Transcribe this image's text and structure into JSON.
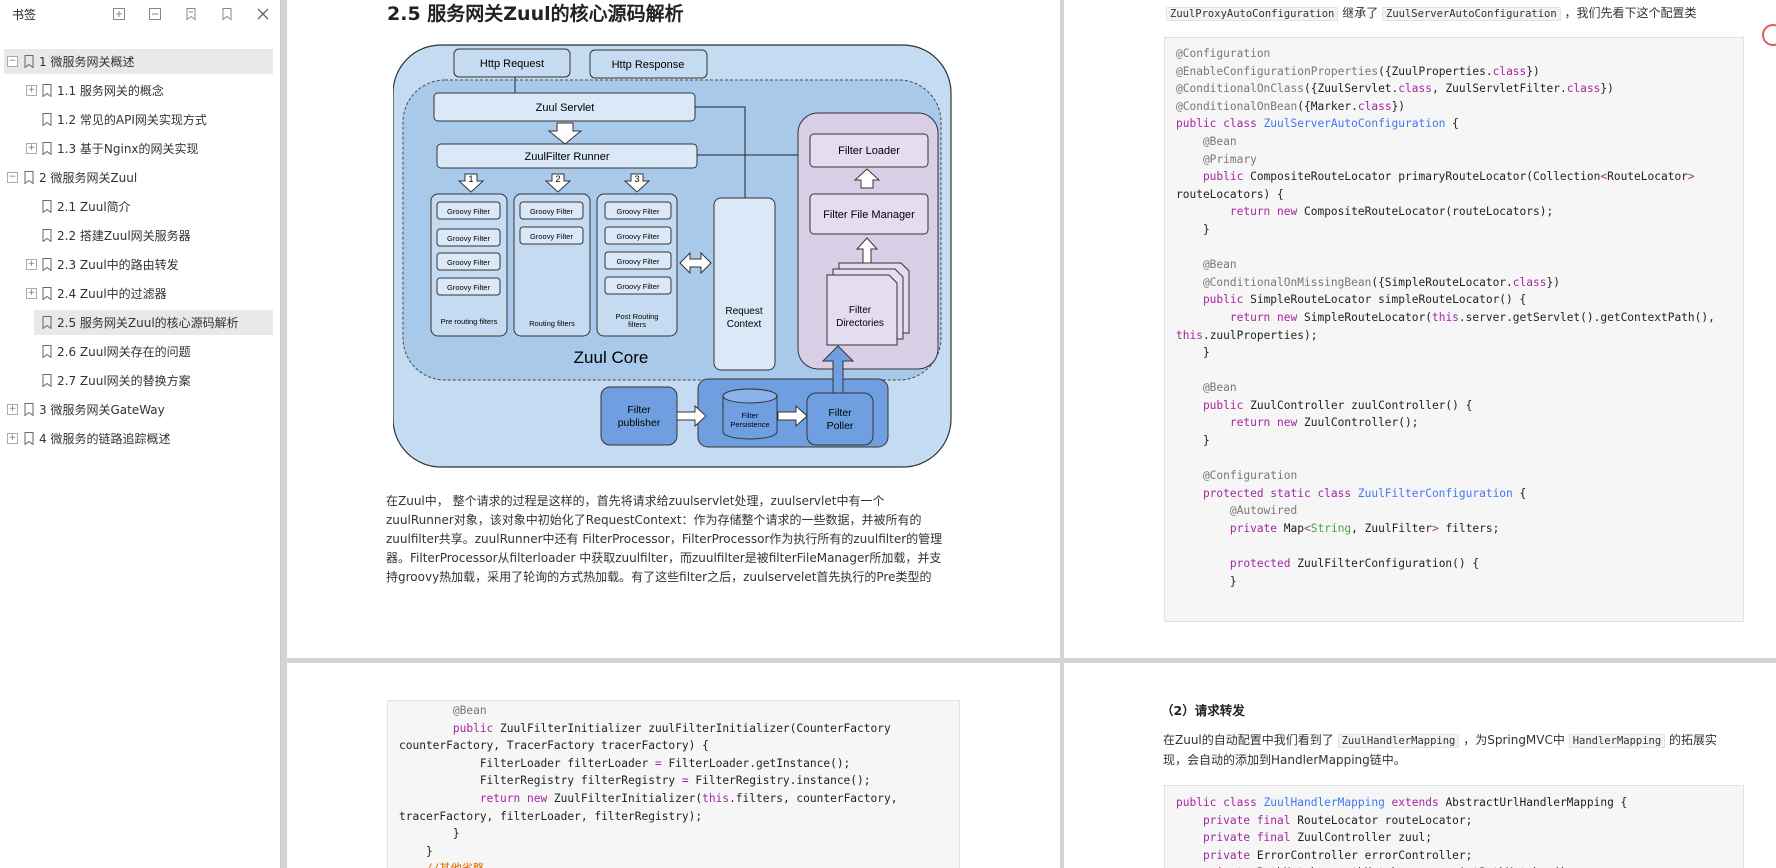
{
  "sidebar": {
    "title": "书签",
    "toc": [
      {
        "label": "1 微服务网关概述",
        "level": 1,
        "sel": true,
        "exp": "⊟"
      },
      {
        "label": "1.1 服务网关的概念",
        "level": 2,
        "exp": "⊞"
      },
      {
        "label": "1.2 常见的API网关实现方式",
        "level": 2,
        "exp": ""
      },
      {
        "label": "1.3 基于Nginx的网关实现",
        "level": 2,
        "exp": "⊞"
      },
      {
        "label": "2 微服务网关Zuul",
        "level": 1,
        "exp": "⊟"
      },
      {
        "label": "2.1 Zuul简介",
        "level": 2,
        "exp": ""
      },
      {
        "label": "2.2 搭建Zuul网关服务器",
        "level": 2,
        "exp": ""
      },
      {
        "label": "2.3 Zuul中的路由转发",
        "level": 2,
        "exp": "⊞"
      },
      {
        "label": "2.4 Zuul中的过滤器",
        "level": 2,
        "exp": "⊞"
      },
      {
        "label": "2.5 服务网关Zuul的核心源码解析",
        "level": 2,
        "sel": true,
        "exp": ""
      },
      {
        "label": "2.6  Zuul网关存在的问题",
        "level": 2,
        "exp": ""
      },
      {
        "label": "2.7 Zuul网关的替换方案",
        "level": 2,
        "exp": ""
      },
      {
        "label": "3 微服务网关GateWay",
        "level": 1,
        "exp": "⊞"
      },
      {
        "label": "4 微服务的链路追踪概述",
        "level": 1,
        "exp": "⊞"
      }
    ]
  },
  "page1": {
    "heading": "2.5 服务网关Zuul的核心源码解析",
    "para": [
      "在Zuul中， 整个请求的过程是这样的，首先将请求给zuulservlet处理，zuulservlet中有一个",
      "zuulRunner对象，该对象中初始化了RequestContext：作为存储整个请求的一些数据，并被所有的",
      "zuulfilter共享。zuulRunner中还有 FilterProcessor，FilterProcessor作为执行所有的zuulfilter的管理",
      "器。FilterProcessor从filterloader 中获取zuulfilter，而zuulfilter是被filterFileManager所加载，并支",
      "持groovy热加载，采用了轮询的方式热加载。有了这些filter之后，zuulservelet首先执行的Pre类型的"
    ]
  },
  "diagram": {
    "http_request": "Http Request",
    "http_response": "Http Response",
    "zuul_servlet": "Zuul Servlet",
    "runner": "ZuulFilter Runner",
    "groovy": "Groovy Filter",
    "pre": "Pre routing filters",
    "routing": "Routing filters",
    "post_1": "Post Routing",
    "post_2": "filters",
    "rc_1": "Request",
    "rc_2": "Context",
    "core": "Zuul Core",
    "loader": "Filter Loader",
    "file_mgr": "Filter File Manager",
    "dir_1": "Filter",
    "dir_2": "Directories",
    "pub_1": "Filter",
    "pub_2": "publisher",
    "pers_1": "Filter",
    "pers_2": "Persistence",
    "poll_1": "Filter",
    "poll_2": "Poller",
    "n1": "1",
    "n2": "2",
    "n3": "3"
  },
  "page2": {
    "intro_a": "ZuulProxyAutoConfiguration",
    "intro_b": " 继承了 ",
    "intro_c": "ZuulServerAutoConfiguration",
    "intro_d": " ，我们先看下这个配置类"
  },
  "page4": {
    "heading": "（2）请求转发",
    "p1a": "在Zuul的自动配置中我们看到了 ",
    "p1b": "ZuulHandlerMapping",
    "p1c": " ，为SpringMVC中 ",
    "p1d": "HandlerMapping",
    "p1e": " 的拓展实",
    "p2": "现，会自动的添加到HandlerMapping链中。"
  },
  "code2": [
    [
      [
        "an",
        "@Configuration"
      ]
    ],
    [
      [
        "an",
        "@EnableConfigurationProperties"
      ],
      [
        "",
        "({ZuulProperties."
      ],
      [
        "kw",
        "class"
      ],
      [
        "",
        "})"
      ]
    ],
    [
      [
        "an",
        "@ConditionalOnClass"
      ],
      [
        "",
        "({ZuulServlet."
      ],
      [
        "kw",
        "class"
      ],
      [
        "",
        ", ZuulServletFilter."
      ],
      [
        "kw",
        "class"
      ],
      [
        "",
        "})"
      ]
    ],
    [
      [
        "an",
        "@ConditionalOnBean"
      ],
      [
        "",
        "({Marker."
      ],
      [
        "kw",
        "class"
      ],
      [
        "",
        "})"
      ]
    ],
    [
      [
        "kw",
        "public class "
      ],
      [
        "ty",
        "ZuulServerAutoConfiguration"
      ],
      [
        "",
        " {"
      ]
    ],
    [
      [
        "an",
        "    @Bean"
      ]
    ],
    [
      [
        "an",
        "    @Primary"
      ]
    ],
    [
      [
        "kw",
        "    public "
      ],
      [
        "",
        "CompositeRouteLocator primaryRouteLocator(Collection"
      ],
      [
        "kw",
        "<"
      ],
      [
        "",
        "RouteLocator"
      ],
      [
        "kw",
        ">"
      ]
    ],
    [
      [
        "",
        "routeLocators) {"
      ]
    ],
    [
      [
        "kw",
        "        return new "
      ],
      [
        "",
        "CompositeRouteLocator(routeLocators);"
      ]
    ],
    [
      [
        "",
        "    }"
      ]
    ],
    [
      [
        "",
        ""
      ]
    ],
    [
      [
        "an",
        "    @Bean"
      ]
    ],
    [
      [
        "an",
        "    @ConditionalOnMissingBean"
      ],
      [
        "",
        "({SimpleRouteLocator."
      ],
      [
        "kw",
        "class"
      ],
      [
        "",
        "})"
      ]
    ],
    [
      [
        "kw",
        "    public "
      ],
      [
        "",
        "SimpleRouteLocator simpleRouteLocator() {"
      ]
    ],
    [
      [
        "kw",
        "        return new "
      ],
      [
        "",
        "SimpleRouteLocator("
      ],
      [
        "kw",
        "this"
      ],
      [
        "",
        ".server.getServlet().getContextPath(),"
      ]
    ],
    [
      [
        "kw",
        "this"
      ],
      [
        "",
        ".zuulProperties);"
      ]
    ],
    [
      [
        "",
        "    }"
      ]
    ],
    [
      [
        "",
        ""
      ]
    ],
    [
      [
        "an",
        "    @Bean"
      ]
    ],
    [
      [
        "kw",
        "    public "
      ],
      [
        "",
        "ZuulController zuulController() {"
      ]
    ],
    [
      [
        "kw",
        "        return new "
      ],
      [
        "",
        "ZuulController();"
      ]
    ],
    [
      [
        "",
        "    }"
      ]
    ],
    [
      [
        "",
        ""
      ]
    ],
    [
      [
        "an",
        "    @Configuration"
      ]
    ],
    [
      [
        "kw",
        "    protected static class "
      ],
      [
        "ty",
        "ZuulFilterConfiguration"
      ],
      [
        "",
        " {"
      ]
    ],
    [
      [
        "an",
        "        @Autowired"
      ]
    ],
    [
      [
        "kw",
        "        private "
      ],
      [
        "",
        "Map"
      ],
      [
        "kw",
        "<"
      ],
      [
        "gr",
        "String"
      ],
      [
        "",
        ", ZuulFilter"
      ],
      [
        "kw",
        "> "
      ],
      [
        "",
        "filters;"
      ]
    ],
    [
      [
        "",
        ""
      ]
    ],
    [
      [
        "kw",
        "        protected "
      ],
      [
        "",
        "ZuulFilterConfiguration() {"
      ]
    ],
    [
      [
        "",
        "        }"
      ]
    ]
  ],
  "code3": [
    [
      [
        "an",
        "        @Bean"
      ]
    ],
    [
      [
        "kw",
        "        public "
      ],
      [
        "",
        "ZuulFilterInitializer zuulFilterInitializer(CounterFactory"
      ]
    ],
    [
      [
        "",
        "counterFactory, TracerFactory tracerFactory) {"
      ]
    ],
    [
      [
        "",
        "            FilterLoader filterLoader "
      ],
      [
        "kw",
        "= "
      ],
      [
        "",
        "FilterLoader.getInstance();"
      ]
    ],
    [
      [
        "",
        "            FilterRegistry filterRegistry "
      ],
      [
        "kw",
        "= "
      ],
      [
        "",
        "FilterRegistry.instance();"
      ]
    ],
    [
      [
        "kw",
        "            return new "
      ],
      [
        "",
        "ZuulFilterInitializer("
      ],
      [
        "kw",
        "this"
      ],
      [
        "",
        ".filters, counterFactory,"
      ]
    ],
    [
      [
        "",
        "tracerFactory, filterLoader, filterRegistry);"
      ]
    ],
    [
      [
        "",
        "        }"
      ]
    ],
    [
      [
        "",
        "    }"
      ]
    ],
    [
      [
        "cm",
        "    //其他省略"
      ]
    ]
  ],
  "code4": [
    [
      [
        "kw",
        "public class "
      ],
      [
        "ty",
        "ZuulHandlerMapping "
      ],
      [
        "kw",
        "extends "
      ],
      [
        "",
        "AbstractUrlHandlerMapping {"
      ]
    ],
    [
      [
        "kw",
        "    private final "
      ],
      [
        "",
        "RouteLocator routeLocator;"
      ]
    ],
    [
      [
        "kw",
        "    private final "
      ],
      [
        "",
        "ZuulController zuul;"
      ]
    ],
    [
      [
        "kw",
        "    private "
      ],
      [
        "",
        "ErrorController errorController;"
      ]
    ],
    [
      [
        "kw",
        "    private "
      ],
      [
        "",
        "PathMatcher pathMatcher = new AntPathMatcher();"
      ]
    ]
  ]
}
